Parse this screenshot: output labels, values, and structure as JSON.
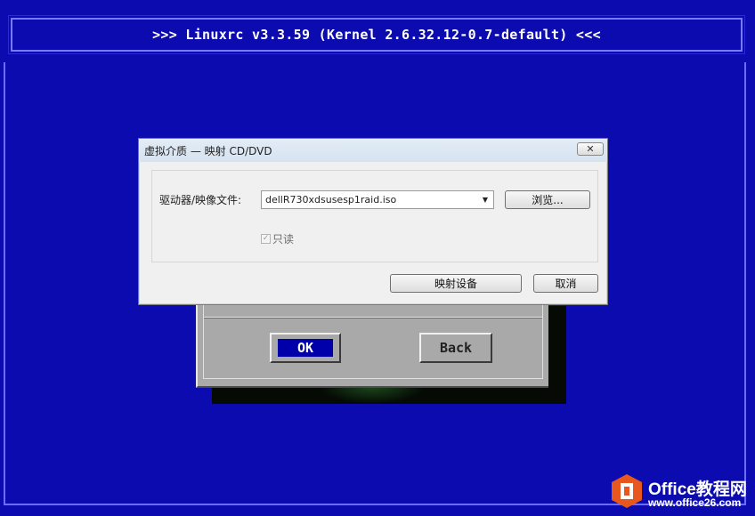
{
  "console": {
    "title": ">>> Linuxrc v3.3.59 (Kernel 2.6.32.12-0.7-default) <<<"
  },
  "installer_dialog": {
    "ok_label": "OK",
    "back_label": "Back"
  },
  "virtual_media_dialog": {
    "title": "虚拟介质 — 映射 CD/DVD",
    "close_glyph": "✕",
    "drive_label": "驱动器/映像文件:",
    "drive_value": "dellR730xdsusesp1raid.iso",
    "browse_label": "浏览...",
    "readonly_label": "只读",
    "readonly_checked": true,
    "map_button_label": "映射设备",
    "cancel_button_label": "取消"
  },
  "watermark": {
    "brand": "Office教程网",
    "url": "www.office26.com"
  },
  "colors": {
    "console_bg": "#0b0bb0",
    "ok_highlight": "#0000aa",
    "watermark_logo": "#e8571e"
  }
}
